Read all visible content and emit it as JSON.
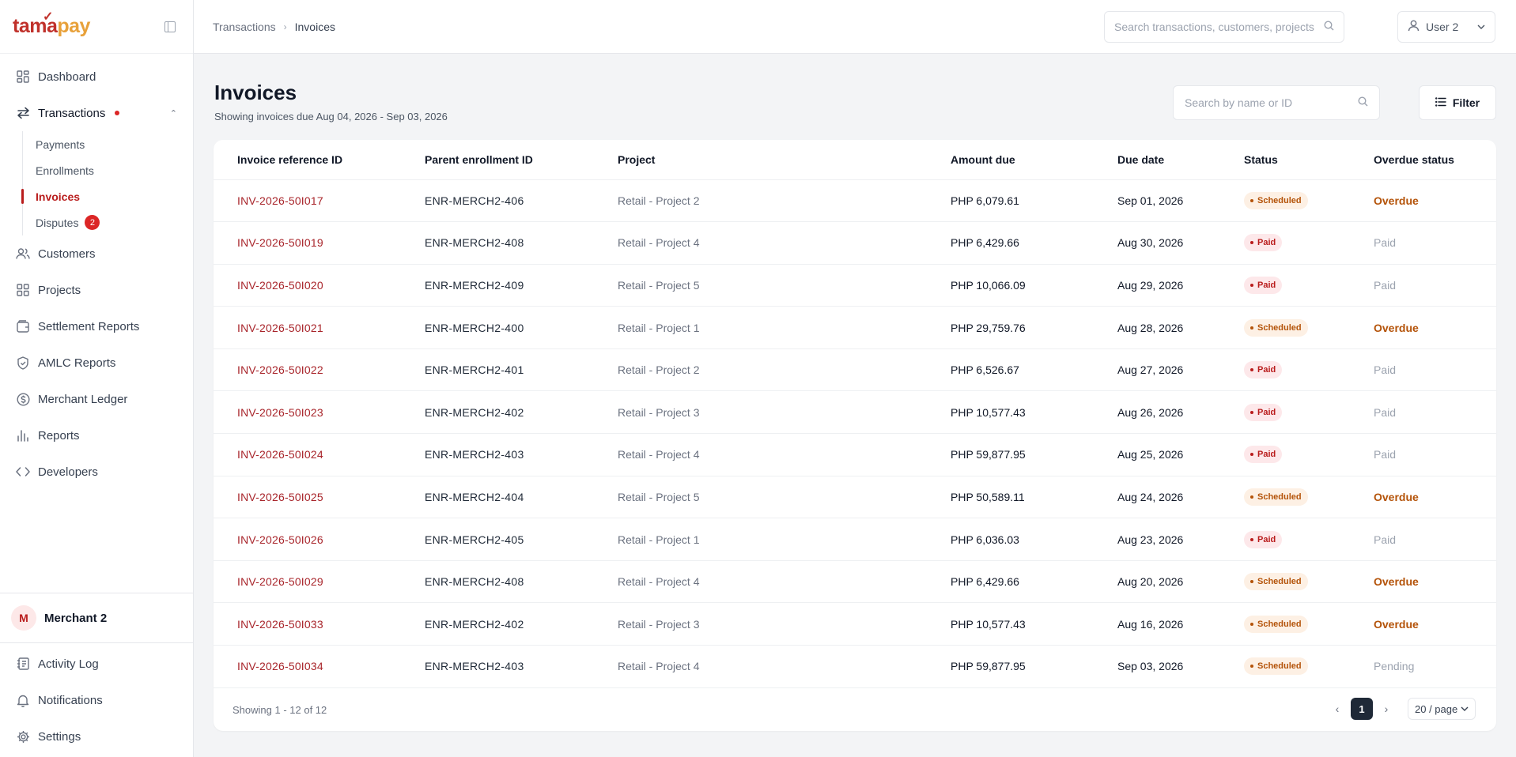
{
  "brand": {
    "part1": "tama",
    "part2": "pay",
    "accent": "#c0312b",
    "accent2": "#e8a13a"
  },
  "sidebar": {
    "items": [
      {
        "label": "Dashboard",
        "icon": "grid-icon"
      },
      {
        "label": "Transactions",
        "icon": "arrows-exchange-icon"
      },
      {
        "label": "Customers",
        "icon": "users-icon"
      },
      {
        "label": "Projects",
        "icon": "grid-icon"
      },
      {
        "label": "Settlement Reports",
        "icon": "wallet-icon"
      },
      {
        "label": "AMLC Reports",
        "icon": "shield-icon"
      },
      {
        "label": "Merchant Ledger",
        "icon": "dollar-circle-icon"
      },
      {
        "label": "Reports",
        "icon": "bar-chart-icon"
      },
      {
        "label": "Developers",
        "icon": "code-icon"
      }
    ],
    "subitems": [
      {
        "label": "Payments"
      },
      {
        "label": "Enrollments"
      },
      {
        "label": "Invoices"
      },
      {
        "label": "Disputes",
        "badge": "2"
      }
    ],
    "merchant": {
      "initial": "M",
      "name": "Merchant 2"
    },
    "bottom": [
      {
        "label": "Activity Log",
        "icon": "log-icon"
      },
      {
        "label": "Notifications",
        "icon": "bell-icon"
      },
      {
        "label": "Settings",
        "icon": "gear-icon"
      }
    ]
  },
  "topbar": {
    "breadcrumb": [
      "Transactions",
      "Invoices"
    ],
    "search_placeholder": "Search transactions, customers, projects",
    "user": "User 2"
  },
  "main": {
    "title": "Invoices",
    "subtitle": "Showing invoices due Aug 04, 2026 - Sep 03, 2026",
    "search_placeholder": "Search by name or ID",
    "filter_label": "Filter",
    "columns": [
      "Invoice reference ID",
      "Parent enrollment ID",
      "Project",
      "Amount due",
      "Due date",
      "Status",
      "Overdue status"
    ],
    "rows": [
      {
        "ref": "INV-2026-50I017",
        "enr": "ENR-MERCH2-406",
        "project": "Retail - Project 2",
        "amount": "PHP 6,079.61",
        "due": "Sep 01, 2026",
        "status": "Scheduled",
        "overdue": "Overdue"
      },
      {
        "ref": "INV-2026-50I019",
        "enr": "ENR-MERCH2-408",
        "project": "Retail - Project 4",
        "amount": "PHP 6,429.66",
        "due": "Aug 30, 2026",
        "status": "Paid",
        "overdue": "Paid"
      },
      {
        "ref": "INV-2026-50I020",
        "enr": "ENR-MERCH2-409",
        "project": "Retail - Project 5",
        "amount": "PHP 10,066.09",
        "due": "Aug 29, 2026",
        "status": "Paid",
        "overdue": "Paid"
      },
      {
        "ref": "INV-2026-50I021",
        "enr": "ENR-MERCH2-400",
        "project": "Retail - Project 1",
        "amount": "PHP 29,759.76",
        "due": "Aug 28, 2026",
        "status": "Scheduled",
        "overdue": "Overdue"
      },
      {
        "ref": "INV-2026-50I022",
        "enr": "ENR-MERCH2-401",
        "project": "Retail - Project 2",
        "amount": "PHP 6,526.67",
        "due": "Aug 27, 2026",
        "status": "Paid",
        "overdue": "Paid"
      },
      {
        "ref": "INV-2026-50I023",
        "enr": "ENR-MERCH2-402",
        "project": "Retail - Project 3",
        "amount": "PHP 10,577.43",
        "due": "Aug 26, 2026",
        "status": "Paid",
        "overdue": "Paid"
      },
      {
        "ref": "INV-2026-50I024",
        "enr": "ENR-MERCH2-403",
        "project": "Retail - Project 4",
        "amount": "PHP 59,877.95",
        "due": "Aug 25, 2026",
        "status": "Paid",
        "overdue": "Paid"
      },
      {
        "ref": "INV-2026-50I025",
        "enr": "ENR-MERCH2-404",
        "project": "Retail - Project 5",
        "amount": "PHP 50,589.11",
        "due": "Aug 24, 2026",
        "status": "Scheduled",
        "overdue": "Overdue"
      },
      {
        "ref": "INV-2026-50I026",
        "enr": "ENR-MERCH2-405",
        "project": "Retail - Project 1",
        "amount": "PHP 6,036.03",
        "due": "Aug 23, 2026",
        "status": "Paid",
        "overdue": "Paid"
      },
      {
        "ref": "INV-2026-50I029",
        "enr": "ENR-MERCH2-408",
        "project": "Retail - Project 4",
        "amount": "PHP 6,429.66",
        "due": "Aug 20, 2026",
        "status": "Scheduled",
        "overdue": "Overdue"
      },
      {
        "ref": "INV-2026-50I033",
        "enr": "ENR-MERCH2-402",
        "project": "Retail - Project 3",
        "amount": "PHP 10,577.43",
        "due": "Aug 16, 2026",
        "status": "Scheduled",
        "overdue": "Overdue"
      },
      {
        "ref": "INV-2026-50I034",
        "enr": "ENR-MERCH2-403",
        "project": "Retail - Project 4",
        "amount": "PHP 59,877.95",
        "due": "Sep 03, 2026",
        "status": "Scheduled",
        "overdue": "Pending"
      }
    ],
    "footer": {
      "showing": "Showing 1 - 12 of 12",
      "page": "1",
      "per_page": "20 / page"
    }
  }
}
